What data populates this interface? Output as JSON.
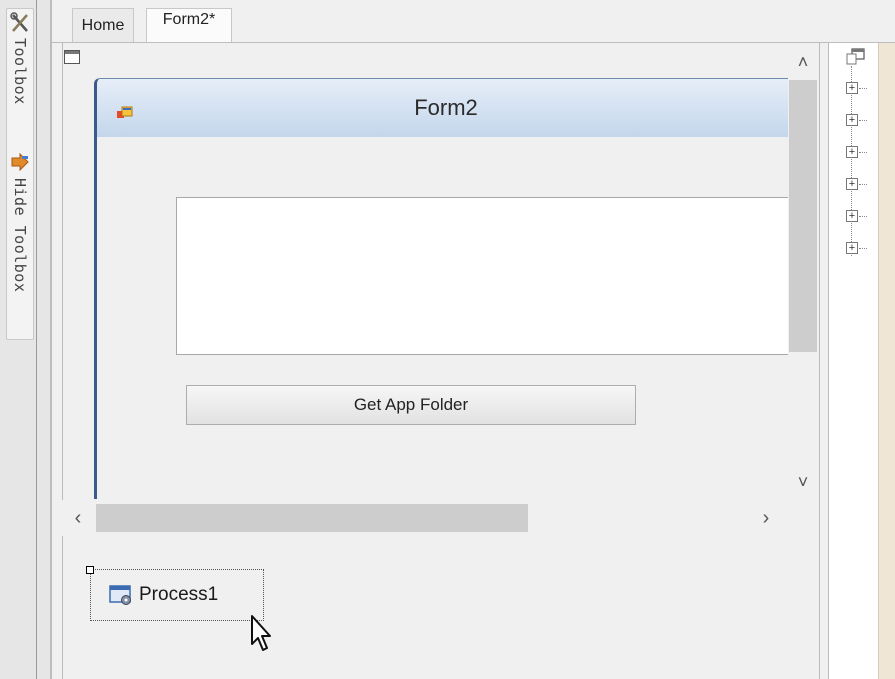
{
  "tabs": [
    {
      "label": "Home"
    },
    {
      "label": "Form2*"
    }
  ],
  "toolbox": {
    "toolbox_label": "Toolbox",
    "hide_label": "Hide Toolbox"
  },
  "form": {
    "title": "Form2",
    "button_label": "Get App Folder"
  },
  "tray": {
    "component_label": "Process1"
  },
  "scroll": {
    "up": "˄",
    "down": "˅",
    "left": "‹",
    "right": "›"
  },
  "tree": {
    "expander": "+"
  },
  "icons": {
    "toolbox": "toolbox-icon",
    "hide_toolbox": "hide-toolbox-icon",
    "form": "form-icon",
    "process": "process-icon",
    "cursor": "mouse-cursor-icon"
  }
}
